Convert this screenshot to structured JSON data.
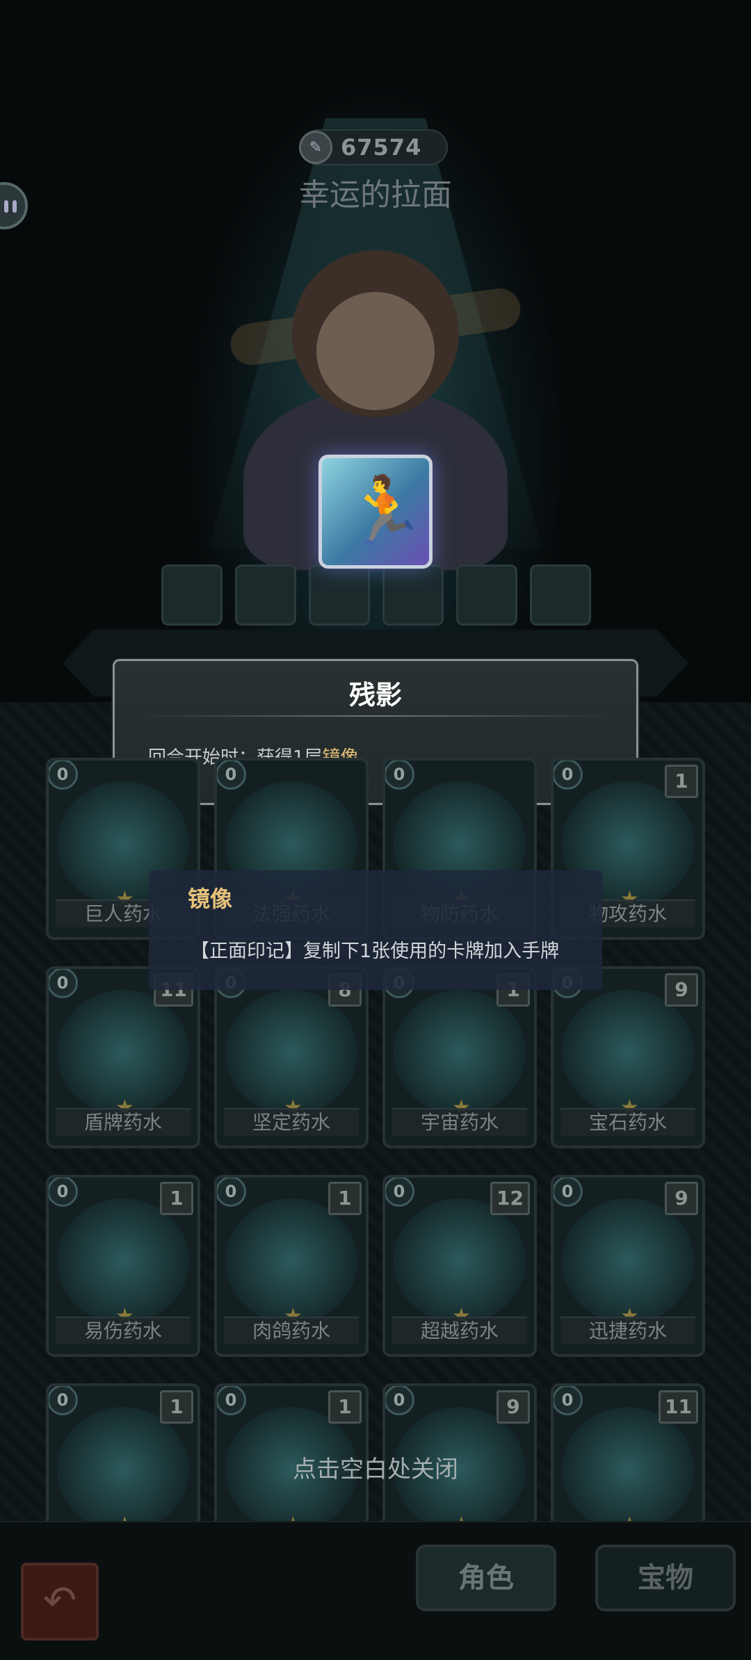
{
  "header": {
    "score": "67574",
    "character_name": "幸运的拉面"
  },
  "popup": {
    "title": "残影",
    "desc_prefix": "回合开始时：获得1层",
    "desc_keyword": "镜像"
  },
  "tooltip": {
    "title": "镜像",
    "desc": "【正面印记】复制下1张使用的卡牌加入手牌"
  },
  "potions": [
    {
      "cost": "0",
      "count": "",
      "name": "巨人药水"
    },
    {
      "cost": "0",
      "count": "",
      "name": "法强药水"
    },
    {
      "cost": "0",
      "count": "",
      "name": "物防药水"
    },
    {
      "cost": "0",
      "count": "1",
      "name": "物攻药水"
    },
    {
      "cost": "0",
      "count": "11",
      "name": "盾牌药水"
    },
    {
      "cost": "0",
      "count": "8",
      "name": "坚定药水"
    },
    {
      "cost": "0",
      "count": "1",
      "name": "宇宙药水"
    },
    {
      "cost": "0",
      "count": "9",
      "name": "宝石药水"
    },
    {
      "cost": "0",
      "count": "1",
      "name": "易伤药水"
    },
    {
      "cost": "0",
      "count": "1",
      "name": "肉鸽药水"
    },
    {
      "cost": "0",
      "count": "12",
      "name": "超越药水"
    },
    {
      "cost": "0",
      "count": "9",
      "name": "迅捷药水"
    },
    {
      "cost": "0",
      "count": "1",
      "name": ""
    },
    {
      "cost": "0",
      "count": "1",
      "name": ""
    },
    {
      "cost": "0",
      "count": "9",
      "name": ""
    },
    {
      "cost": "0",
      "count": "11",
      "name": ""
    }
  ],
  "close_hint": "点击空白处关闭",
  "tabs": {
    "role": "角色",
    "treasure": "宝物"
  }
}
